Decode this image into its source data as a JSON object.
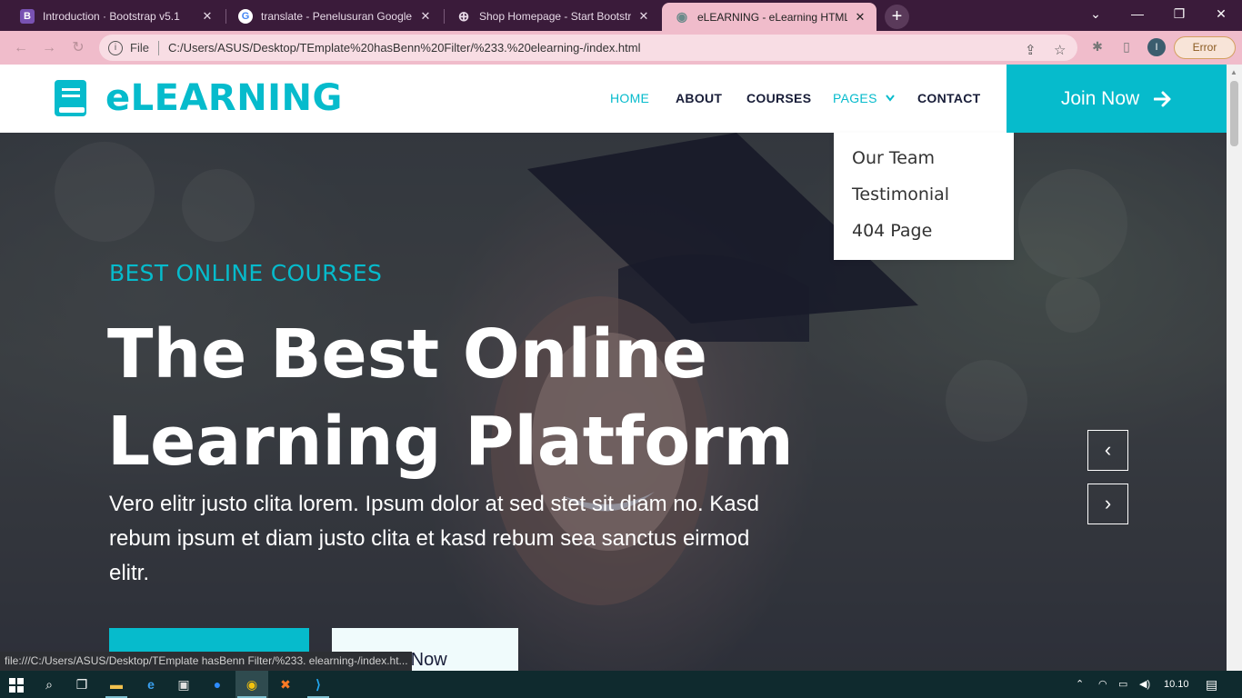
{
  "browser": {
    "tabs": [
      {
        "title": "Introduction · Bootstrap v5.1",
        "icon": "bootstrap-icon",
        "icon_text": "B",
        "icon_color": "#7952b3",
        "close": "✕"
      },
      {
        "title": "translate - Penelusuran Google",
        "icon": "google-icon",
        "icon_text": "G",
        "icon_color": "#ffffff",
        "close": "✕"
      },
      {
        "title": "Shop Homepage - Start Bootstrap",
        "icon": "globe-icon",
        "icon_text": "⊕",
        "icon_color": "#3a1b3a",
        "close": "✕"
      },
      {
        "title": "eLEARNING - eLearning HTML Te",
        "icon": "globe-icon",
        "icon_text": "◉",
        "icon_color": "#f0bccb",
        "close": "✕"
      }
    ],
    "new_tab": "+",
    "window_controls": {
      "minimize": "—",
      "restore": "❐",
      "close": "✕",
      "tab_search": "⌄"
    },
    "address": {
      "file_label": "File",
      "url": "C:/Users/ASUS/Desktop/TEmplate%20hasBenn%20Filter/%233.%20elearning-/index.html"
    },
    "profile_initial": "I",
    "error_label": "Error",
    "status_url": "file:///C:/Users/ASUS/Desktop/TEmplate hasBenn Filter/%233. elearning-/index.ht..."
  },
  "site": {
    "brand": "eLEARNING",
    "accent": "#06bbcc",
    "dark": "#181d38",
    "nav": [
      {
        "label": "HOME",
        "active": true
      },
      {
        "label": "ABOUT",
        "active": false
      },
      {
        "label": "COURSES",
        "active": false
      },
      {
        "label": "PAGES",
        "active": false,
        "dropdown": true
      },
      {
        "label": "CONTACT",
        "active": false
      }
    ],
    "join_button": "Join Now",
    "dropdown_items": [
      "Our Team",
      "Testimonial",
      "404 Page"
    ]
  },
  "hero": {
    "subtitle": "BEST ONLINE COURSES",
    "headline_line1": "The Best Online",
    "headline_line2": "Learning Platform",
    "lead": "Vero elitr justo clita lorem. Ipsum dolor at sed stet sit diam no. Kasd rebum ipsum et diam justo clita et kasd rebum sea sanctus eirmod elitr.",
    "secondary_button": "Join Now",
    "secondary_button_visible": "n Now",
    "prev": "‹",
    "next": "›"
  },
  "taskbar": {
    "time": "10.10",
    "items": [
      "windows-start-icon",
      "search-icon",
      "task-view-icon",
      "file-explorer-icon",
      "edge-icon",
      "store-icon",
      "zoom-icon",
      "chrome-icon",
      "xampp-icon",
      "vscode-icon"
    ]
  }
}
